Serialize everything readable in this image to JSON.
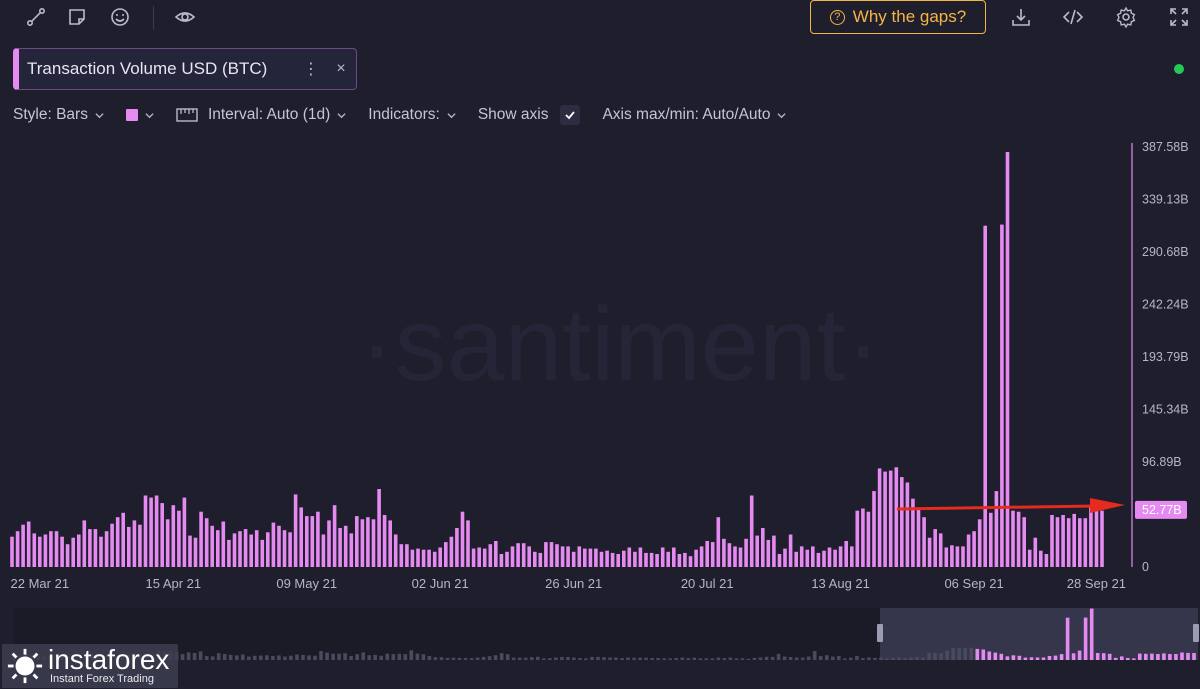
{
  "toolbar": {
    "icons": [
      "pencil-line-icon",
      "sticky-note-icon",
      "smiley-icon",
      "eye-icon",
      "download-icon",
      "code-icon",
      "gear-icon",
      "expand-icon"
    ],
    "gaps_button_label": "Why the gaps?",
    "gaps_icon": "question-icon"
  },
  "metric": {
    "title": "Transaction Volume USD (BTC)",
    "more_label": "⋮",
    "close_label": "×",
    "color": "#e58af0"
  },
  "status": {
    "color": "#26c953"
  },
  "settings": {
    "style_label": "Style: Bars",
    "interval_label": "Interval: Auto (1d)",
    "indicators_label": "Indicators:",
    "show_axis_label": "Show axis",
    "show_axis_checked": true,
    "axis_label": "Axis max/min: Auto/Auto"
  },
  "watermark": {
    "text": "·santiment·"
  },
  "brand": {
    "name": "instaforex",
    "tagline": "Instant Forex Trading"
  },
  "chart_data": {
    "type": "bar",
    "x_ticks": [
      "22 Mar 21",
      "15 Apr 21",
      "09 May 21",
      "02 Jun 21",
      "26 Jun 21",
      "20 Jul 21",
      "13 Aug 21",
      "06 Sep 21",
      "28 Sep 21"
    ],
    "y_ticks": [
      "0",
      "52.77B",
      "96.89B",
      "145.34B",
      "193.79B",
      "242.24B",
      "290.68B",
      "339.13B",
      "387.58B"
    ],
    "ylim": [
      0,
      387.58
    ],
    "unit": "B",
    "current_value_label": "52.77B",
    "annotation": "red arrow pointing at current level",
    "start_date": "2021-03-17",
    "end_date": "2021-09-29",
    "values": [
      28,
      33,
      39,
      42,
      31,
      28,
      30,
      33,
      33,
      28,
      21,
      27,
      30,
      43,
      35,
      35,
      28,
      33,
      40,
      46,
      50,
      37,
      43,
      39,
      66,
      64,
      66,
      59,
      44,
      57,
      52,
      64,
      29,
      27,
      51,
      45,
      38,
      34,
      42,
      25,
      31,
      33,
      35,
      30,
      34,
      25,
      32,
      41,
      38,
      34,
      32,
      67,
      55,
      47,
      47,
      51,
      30,
      43,
      57,
      36,
      38,
      31,
      47,
      44,
      46,
      44,
      72,
      48,
      43,
      30,
      21,
      21,
      16,
      17,
      16,
      16,
      14,
      18,
      23,
      28,
      36,
      51,
      43,
      17,
      18,
      17,
      21,
      24,
      12,
      14,
      19,
      22,
      22,
      19,
      14,
      13,
      23,
      23,
      21,
      19,
      19,
      14,
      19,
      17,
      17,
      17,
      14,
      15,
      13,
      12,
      15,
      18,
      14,
      18,
      13,
      13,
      12,
      18,
      14,
      18,
      12,
      13,
      10,
      16,
      19,
      24,
      23,
      46,
      26,
      22,
      19,
      18,
      26,
      66,
      29,
      36,
      25,
      29,
      12,
      17,
      30,
      14,
      19,
      16,
      19,
      13,
      15,
      18,
      16,
      19,
      24,
      19,
      52,
      54,
      51,
      70,
      91,
      88,
      89,
      92,
      83,
      78,
      63,
      55,
      46,
      27,
      35,
      31,
      18,
      20,
      19,
      19,
      30,
      33,
      44,
      315,
      50,
      70,
      316,
      383,
      52,
      51,
      46,
      16,
      27,
      15,
      12,
      48,
      46,
      48,
      45,
      49,
      45,
      45,
      56,
      53,
      52
    ]
  }
}
